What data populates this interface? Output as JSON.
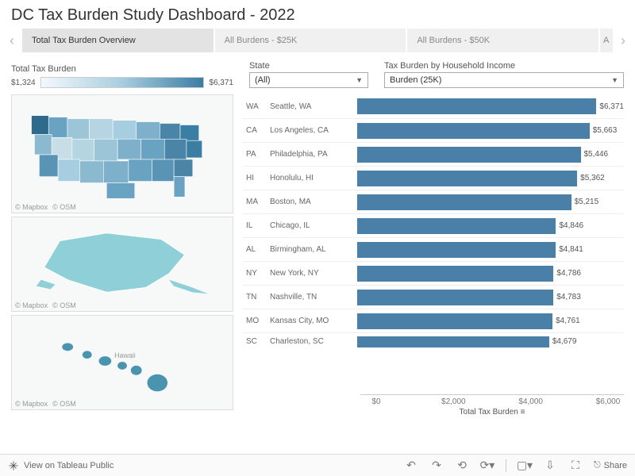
{
  "title": "DC Tax Burden Study Dashboard - 2022",
  "tabs": {
    "items": [
      "Total Tax Burden Overview",
      "All Burdens - $25K",
      "All Burdens - $50K"
    ],
    "partial": "A",
    "active_index": 0
  },
  "legend": {
    "title": "Total Tax Burden",
    "min": "$1,324",
    "max": "$6,371"
  },
  "state_filter": {
    "label": "State",
    "value": "(All)"
  },
  "income_filter": {
    "label": "Tax Burden by Household Income",
    "value": "Burden (25K)"
  },
  "map_credits": {
    "mapbox": "© Mapbox",
    "osm": "© OSM"
  },
  "map_region_labels": {
    "hawaii": "Hawaii"
  },
  "chart_data": {
    "type": "bar",
    "title": "",
    "xlabel": "Total Tax Burden",
    "ylabel": "",
    "xlim": [
      0,
      6500
    ],
    "ticks": [
      "$0",
      "$2,000",
      "$4,000",
      "$6,000"
    ],
    "sort": "desc",
    "series": [
      {
        "state": "WA",
        "city": "Seattle, WA",
        "value": 6371,
        "label": "$6,371"
      },
      {
        "state": "CA",
        "city": "Los Angeles, CA",
        "value": 5663,
        "label": "$5,663"
      },
      {
        "state": "PA",
        "city": "Philadelphia, PA",
        "value": 5446,
        "label": "$5,446"
      },
      {
        "state": "HI",
        "city": "Honolulu, HI",
        "value": 5362,
        "label": "$5,362"
      },
      {
        "state": "MA",
        "city": "Boston, MA",
        "value": 5215,
        "label": "$5,215"
      },
      {
        "state": "IL",
        "city": "Chicago, IL",
        "value": 4846,
        "label": "$4,846"
      },
      {
        "state": "AL",
        "city": "Birmingham, AL",
        "value": 4841,
        "label": "$4,841"
      },
      {
        "state": "NY",
        "city": "New York, NY",
        "value": 4786,
        "label": "$4,786"
      },
      {
        "state": "TN",
        "city": "Nashville, TN",
        "value": 4783,
        "label": "$4,783"
      },
      {
        "state": "MO",
        "city": "Kansas City, MO",
        "value": 4761,
        "label": "$4,761"
      },
      {
        "state": "SC",
        "city": "Charleston, SC",
        "value": 4679,
        "label": "$4,679"
      }
    ]
  },
  "axis_title": "Total Tax Burden",
  "footer": {
    "view_on": "View on Tableau Public",
    "share": "Share"
  }
}
